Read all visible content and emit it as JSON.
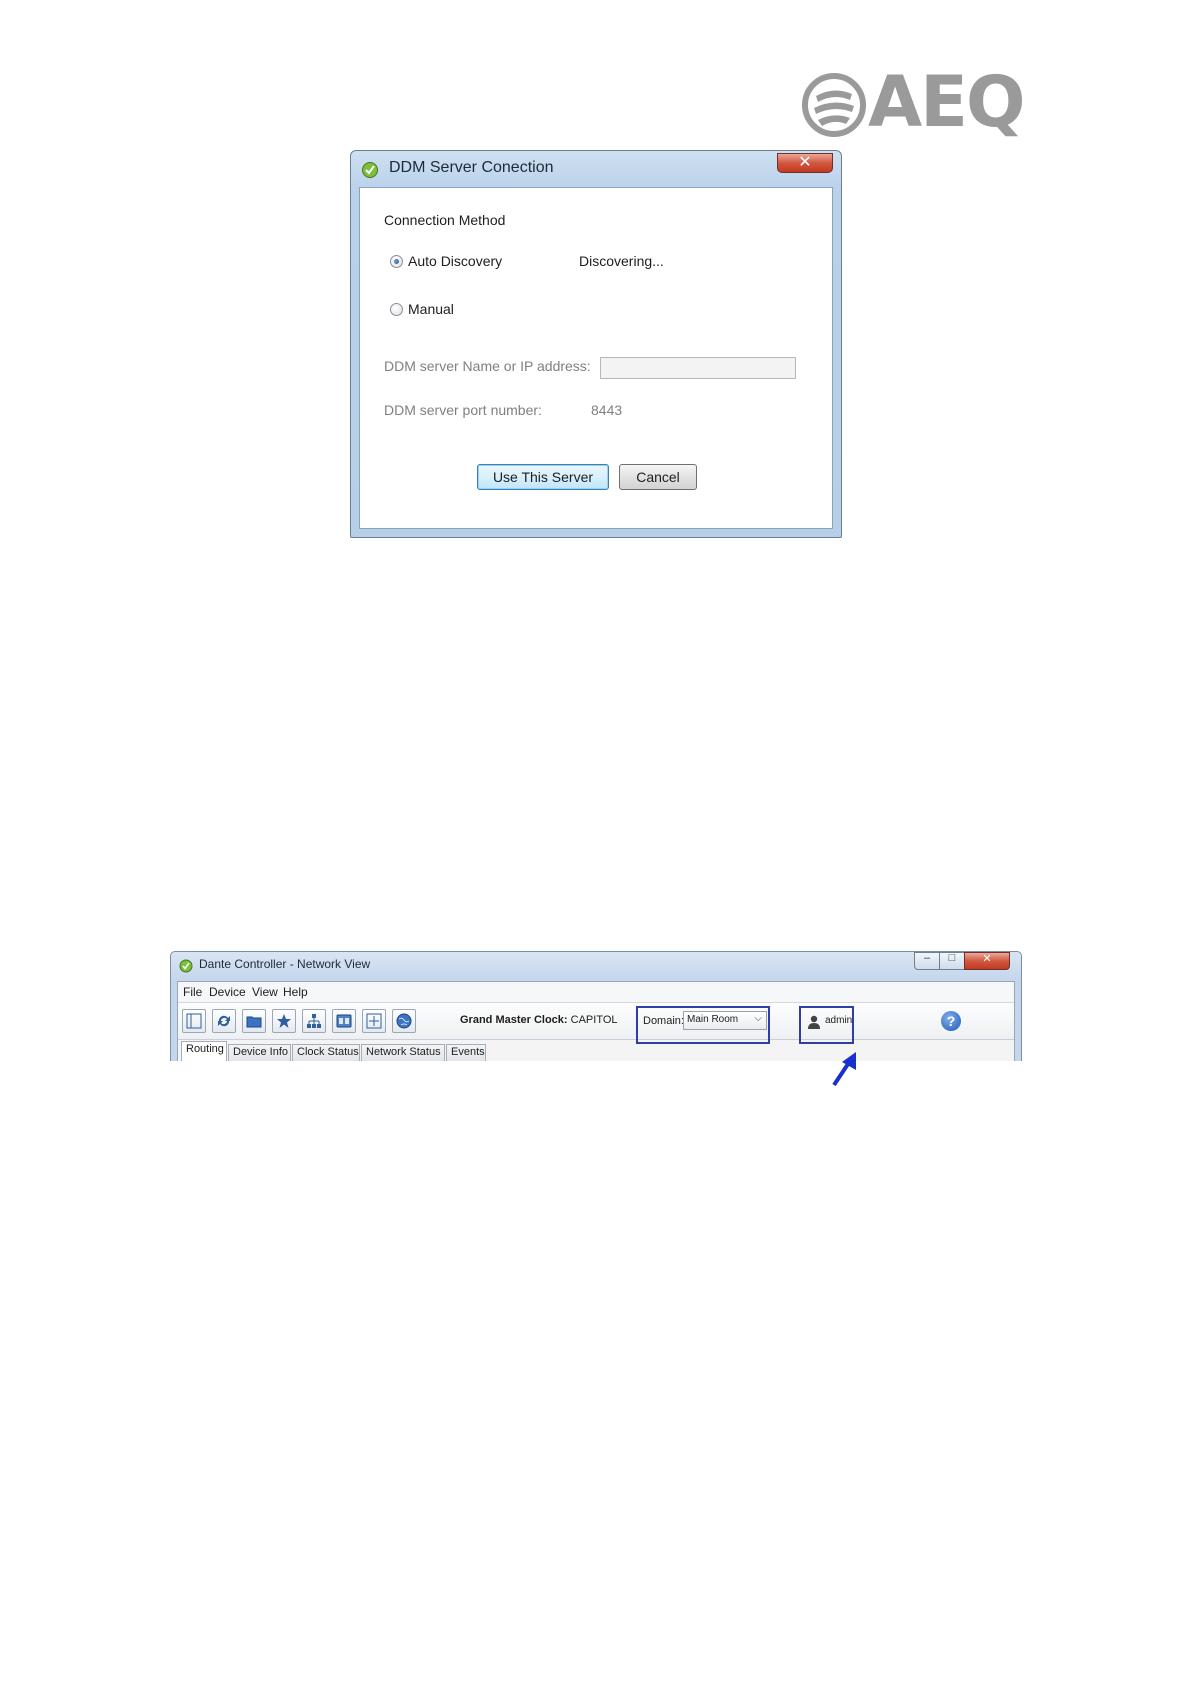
{
  "logo": {
    "text": "AEQ"
  },
  "dialog": {
    "title": "DDM Server Conection",
    "close_glyph": "✕",
    "section_label": "Connection Method",
    "options": [
      {
        "label": "Auto Discovery",
        "selected": true
      },
      {
        "label": "Manual",
        "selected": false
      }
    ],
    "status": "Discovering...",
    "server_name_label": "DDM server Name or IP address:",
    "server_name_value": "",
    "port_label": "DDM server port number:",
    "port_value": "8443",
    "use_button": "Use This Server",
    "cancel_button": "Cancel"
  },
  "app": {
    "title": "Dante Controller - Network View",
    "window_buttons": {
      "minimize": "–",
      "maximize": "□",
      "close": "✕"
    },
    "menu": [
      "File",
      "Device",
      "View",
      "Help"
    ],
    "toolbar_icons": [
      "panel-toggle-icon",
      "refresh-icon",
      "open-folder-icon",
      "favorite-star-icon",
      "network-tree-icon",
      "device-view-icon",
      "add-icon",
      "globe-icon"
    ],
    "grand_master_label": "Grand Master Clock:",
    "grand_master_value": "CAPITOL",
    "domain_label": "Domain:",
    "domain_value": "Main Room",
    "user": "admin",
    "help_glyph": "?",
    "tabs": [
      {
        "label": "Routing",
        "active": true
      },
      {
        "label": "Device Info",
        "active": false
      },
      {
        "label": "Clock Status",
        "active": false
      },
      {
        "label": "Network Status",
        "active": false
      },
      {
        "label": "Events",
        "active": false
      }
    ]
  },
  "colors": {
    "highlight": "#2d3ea8",
    "arrow": "#1a2fcf"
  }
}
